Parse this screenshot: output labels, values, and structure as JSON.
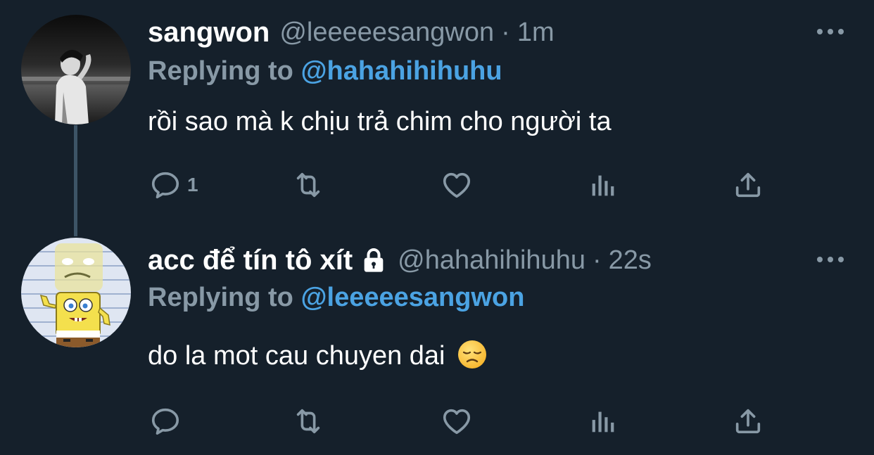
{
  "tweets": [
    {
      "display_name": "sangwon",
      "handle": "@leeeeesangwon",
      "separator": "·",
      "time": "1m",
      "replying_prefix": "Replying to",
      "replying_to": "@hahahihihuhu",
      "text": "rồi sao mà k chịu trả chim cho người ta",
      "reply_count": "1",
      "protected": false
    },
    {
      "display_name": "acc để tín tô xít",
      "handle": "@hahahihihuhu",
      "separator": "·",
      "time": "22s",
      "replying_prefix": "Replying to",
      "replying_to": "@leeeeesangwon",
      "text": "do la mot cau chuyen dai",
      "reply_count": "",
      "protected": true,
      "emoji": "disappointed-face"
    }
  ],
  "icons": {
    "reply": "reply-icon",
    "retweet": "retweet-icon",
    "like": "heart-icon",
    "analytics": "analytics-icon",
    "share": "share-icon",
    "more": "more-icon",
    "lock": "lock-icon"
  },
  "colors": {
    "background": "#15202b",
    "secondary_text": "#8899a6",
    "link": "#4ba3e3",
    "thread_line": "#3d5466"
  }
}
